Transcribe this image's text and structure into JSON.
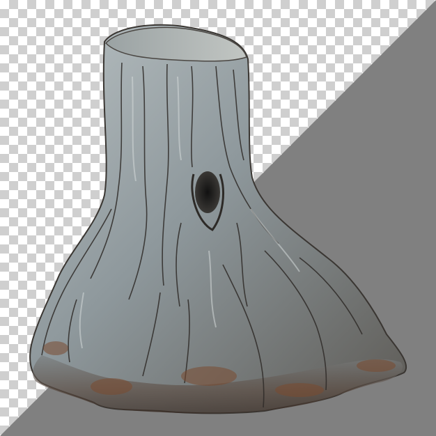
{
  "scene": {
    "subject": "tree-stump",
    "colors": {
      "transparency_light": "#ffffff",
      "transparency_dark": "#cfcfcf",
      "background_triangle": "#808080",
      "wood_light": "#a9b3b8",
      "wood_mid": "#7f8a90",
      "wood_dark": "#3e3a36",
      "wood_rust": "#7a4a30"
    }
  }
}
